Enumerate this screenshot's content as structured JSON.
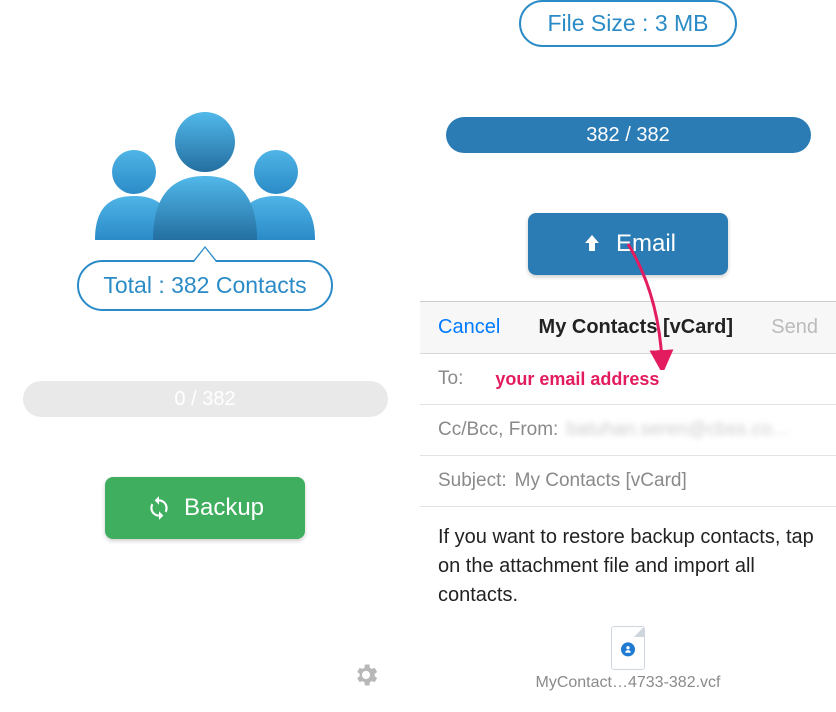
{
  "left": {
    "total_label": "Total : 382 Contacts",
    "progress_text": "0 / 382",
    "backup_label": "Backup"
  },
  "right": {
    "file_size_label": "File Size : 3 MB",
    "progress_text": "382 / 382",
    "email_label": "Email",
    "compose": {
      "cancel": "Cancel",
      "title": "My Contacts [vCard]",
      "send": "Send",
      "to_label": "To:",
      "to_annotation": "your email address",
      "ccbcc_label": "Cc/Bcc, From:",
      "ccbcc_value": "batuhan.seren@cbss.co…",
      "subject_label": "Subject:",
      "subject_value": "My Contacts [vCard]",
      "body": "If you want to restore backup contacts, tap on the attachment file and import all contacts.",
      "attachment_name": "MyContact…4733-382.vcf"
    }
  },
  "colors": {
    "primary_blue": "#2b8bc7",
    "button_blue": "#2b7cb5",
    "green": "#3fae5e",
    "annotation": "#e31b5f"
  }
}
